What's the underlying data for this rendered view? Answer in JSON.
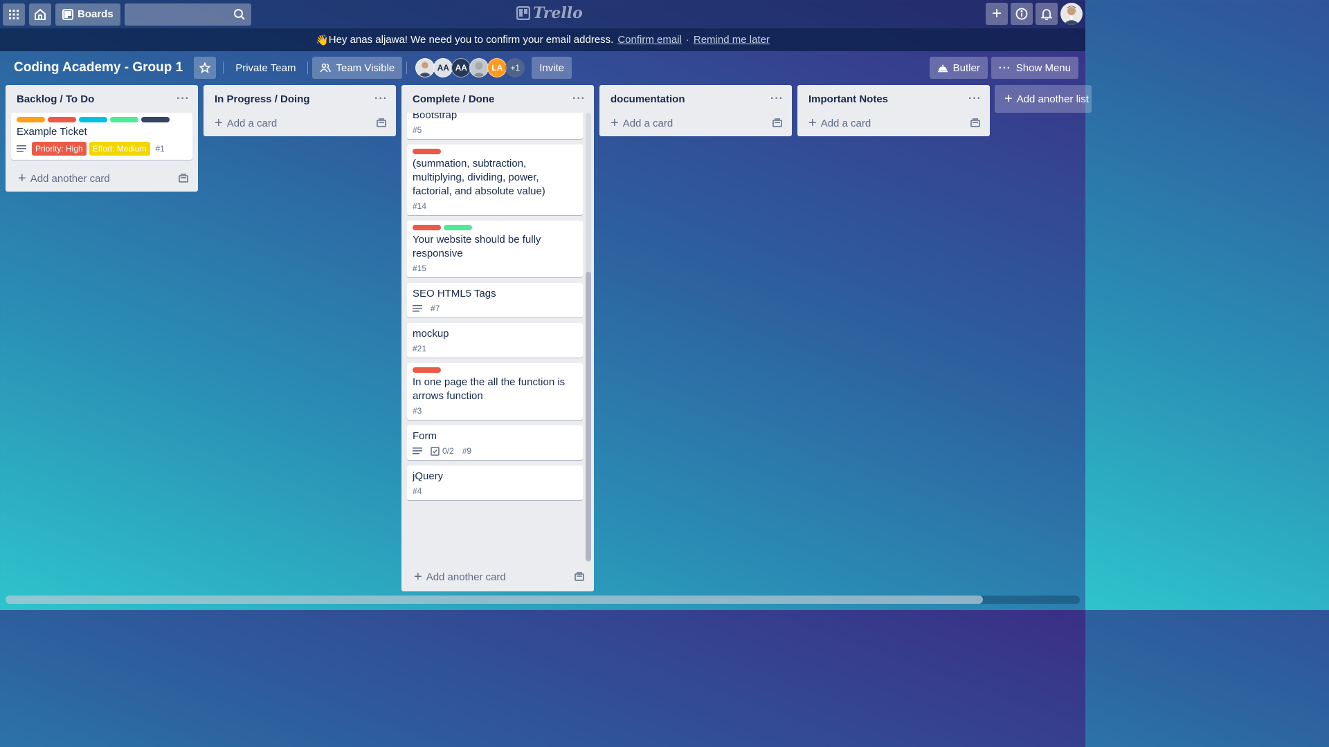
{
  "topbar": {
    "boards_label": "Boards",
    "search_placeholder": "",
    "logo_text": "Trello"
  },
  "banner": {
    "wave": "👋",
    "message": "Hey anas aljawa! We need you to confirm your email address.",
    "confirm_link": "Confirm email",
    "separator": "·",
    "remind_link": "Remind me later"
  },
  "board": {
    "title": "Coding Academy - Group 1",
    "team_label": "Private Team",
    "visibility_label": "Team Visible",
    "members": [
      {
        "initials": "",
        "color": "#dfe1e6",
        "text_color": "#172b4d"
      },
      {
        "initials": "AA",
        "color": "#dfe1e6",
        "text_color": "#172b4d"
      },
      {
        "initials": "AA",
        "color": "#253858",
        "text_color": "#ffffff"
      },
      {
        "initials": "",
        "color": "#c1c7d0",
        "text_color": "#172b4d"
      },
      {
        "initials": "LA",
        "color": "#ff991f",
        "text_color": "#ffffff"
      },
      {
        "initials": "+1",
        "color": "#5e6c84",
        "text_color": "#ffffff"
      }
    ],
    "invite_label": "Invite",
    "butler_label": "Butler",
    "show_menu_label": "Show Menu"
  },
  "lists": {
    "backlog": {
      "title": "Backlog / To Do",
      "more": "···",
      "add_card": "Add another card",
      "card": {
        "labels": [
          "#ff9f1a",
          "#eb5a46",
          "#00c2e0",
          "#51e898",
          "#344563"
        ],
        "title": "Example Ticket",
        "priority": "Priority: High",
        "priority_color": "#eb5a46",
        "effort": "Effort: Medium",
        "effort_color": "#f2d600",
        "number": "#1"
      }
    },
    "progress": {
      "title": "In Progress / Doing",
      "more": "···",
      "add_card": "Add a card"
    },
    "complete": {
      "title": "Complete / Done",
      "more": "···",
      "add_card": "Add another card",
      "cards": {
        "c0": {
          "title": "Bootstrap",
          "number": "#5"
        },
        "c1": {
          "title": "(summation, subtraction, multiplying, dividing, power, factorial, and absolute value)",
          "number": "#14"
        },
        "c2": {
          "title": "Your website should be fully responsive",
          "number": "#15"
        },
        "c3": {
          "title": "SEO HTML5 Tags",
          "number": "#7"
        },
        "c4": {
          "title": "mockup",
          "number": "#21"
        },
        "c5": {
          "title": "In one page the all the function is arrows function",
          "number": "#3"
        },
        "c6": {
          "title": "Form",
          "checklist": "0/2",
          "number": "#9"
        },
        "c7": {
          "title": "jQuery",
          "number": "#4"
        }
      }
    },
    "documentation": {
      "title": "documentation",
      "more": "···",
      "add_card": "Add a card"
    },
    "notes": {
      "title": "Important Notes",
      "more": "···",
      "add_card": "Add a card"
    }
  },
  "add_list_label": "Add another list",
  "colors": {
    "label_red": "#eb5a46",
    "label_green": "#51e898"
  }
}
